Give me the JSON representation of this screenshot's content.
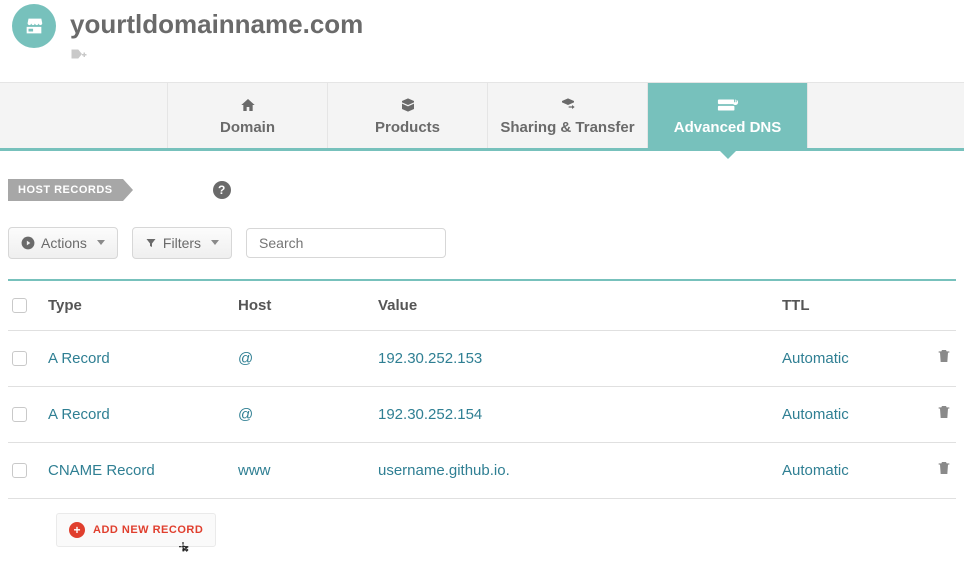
{
  "header": {
    "domain": "yourtldomainname.com",
    "tag_icon_label": "tag-add"
  },
  "tabs": [
    {
      "id": "domain",
      "label": "Domain"
    },
    {
      "id": "products",
      "label": "Products"
    },
    {
      "id": "sharing",
      "label": "Sharing & Transfer"
    },
    {
      "id": "advanced",
      "label": "Advanced DNS",
      "active": true
    }
  ],
  "section": {
    "title": "HOST RECORDS",
    "help": "?"
  },
  "toolbar": {
    "actions_label": "Actions",
    "filters_label": "Filters",
    "search_placeholder": "Search"
  },
  "table": {
    "headers": {
      "type": "Type",
      "host": "Host",
      "value": "Value",
      "ttl": "TTL"
    },
    "rows": [
      {
        "type": "A Record",
        "host": "@",
        "value": "192.30.252.153",
        "ttl": "Automatic"
      },
      {
        "type": "A Record",
        "host": "@",
        "value": "192.30.252.154",
        "ttl": "Automatic"
      },
      {
        "type": "CNAME Record",
        "host": "www",
        "value": "username.github.io.",
        "ttl": "Automatic"
      }
    ]
  },
  "add_button": {
    "label": "ADD NEW RECORD"
  },
  "colors": {
    "accent": "#77c1bc",
    "link": "#2f7f93",
    "danger": "#e03f2e"
  }
}
